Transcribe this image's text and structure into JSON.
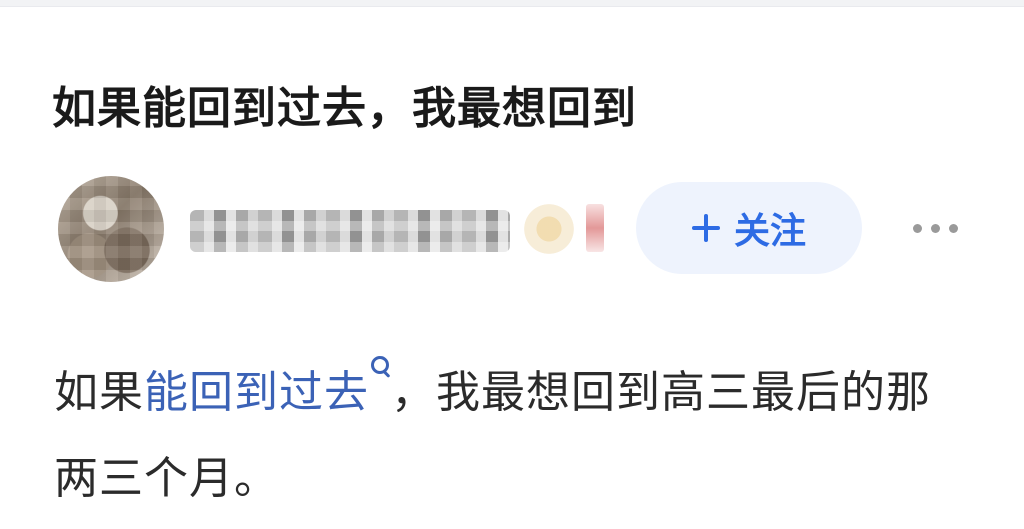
{
  "question": {
    "title": "如果能回到过去，我最想回到"
  },
  "author": {
    "avatar_icon": "avatar-blurred",
    "username_visibility": "blurred",
    "follow_label": "关注",
    "follow_icon": "plus-icon",
    "more_icon": "more-dots-icon"
  },
  "answer": {
    "prefix": "如果",
    "keyword": "能回到过去",
    "keyword_icon": "search-icon",
    "suffix": "，我最想回到高三最后的那两三个月。"
  },
  "colors": {
    "accent": "#2d6be4",
    "link": "#3b62b6",
    "follow_bg": "#eef3fd",
    "title": "#1a1a1a",
    "text": "#2b2b2b"
  }
}
